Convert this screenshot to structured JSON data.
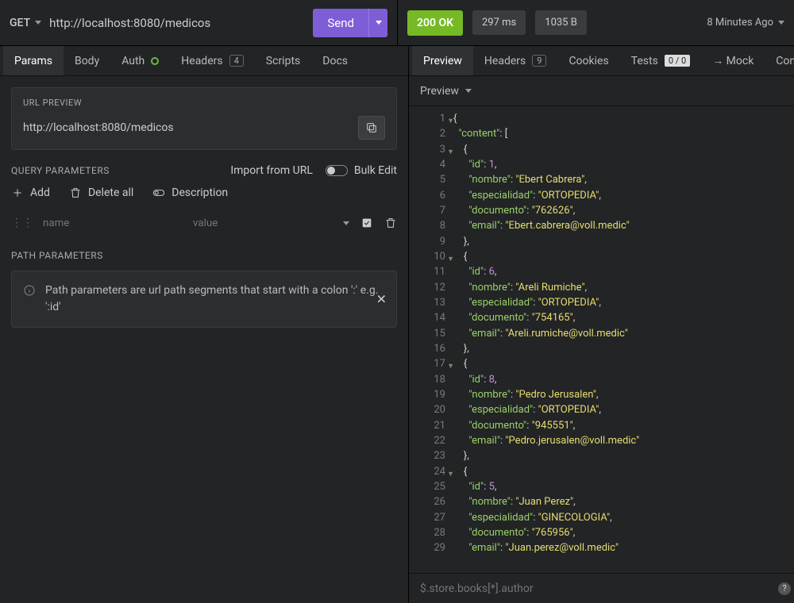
{
  "request": {
    "method": "GET",
    "url": "http://localhost:8080/medicos",
    "send_label": "Send"
  },
  "response_meta": {
    "status": "200 OK",
    "time": "297 ms",
    "size": "1035 B",
    "ago": "8 Minutes Ago"
  },
  "req_tabs": {
    "params": "Params",
    "body": "Body",
    "auth": "Auth",
    "headers": "Headers",
    "headers_count": "4",
    "scripts": "Scripts",
    "docs": "Docs"
  },
  "resp_tabs": {
    "preview": "Preview",
    "headers": "Headers",
    "headers_count": "9",
    "cookies": "Cookies",
    "tests": "Tests",
    "tests_count": "0 / 0",
    "mock": "→ Mock",
    "con": "Con"
  },
  "url_preview": {
    "title": "URL PREVIEW",
    "value": "http://localhost:8080/medicos"
  },
  "query_params": {
    "title": "QUERY PARAMETERS",
    "import": "Import from URL",
    "bulk": "Bulk Edit",
    "add": "Add",
    "delete_all": "Delete all",
    "description": "Description",
    "name_placeholder": "name",
    "value_placeholder": "value"
  },
  "path_params": {
    "title": "PATH PARAMETERS",
    "info": "Path parameters are url path segments that start with a colon ':' e.g. ':id'"
  },
  "preview_header": "Preview",
  "jsonpath_placeholder": "$.store.books[*].author",
  "response_body": {
    "content": [
      {
        "id": 1,
        "nombre": "Ebert Cabrera",
        "especialidad": "ORTOPEDIA",
        "documento": "762626",
        "email": "Ebert.cabrera@voll.medic"
      },
      {
        "id": 6,
        "nombre": "Areli Rumiche",
        "especialidad": "ORTOPEDIA",
        "documento": "754165",
        "email": "Areli.rumiche@voll.medic"
      },
      {
        "id": 8,
        "nombre": "Pedro Jerusalen",
        "especialidad": "ORTOPEDIA",
        "documento": "945551",
        "email": "Pedro.jerusalen@voll.medic"
      },
      {
        "id": 5,
        "nombre": "Juan Perez",
        "especialidad": "GINECOLOGIA",
        "documento": "765956",
        "email": "Juan.perez@voll.medic"
      }
    ]
  }
}
